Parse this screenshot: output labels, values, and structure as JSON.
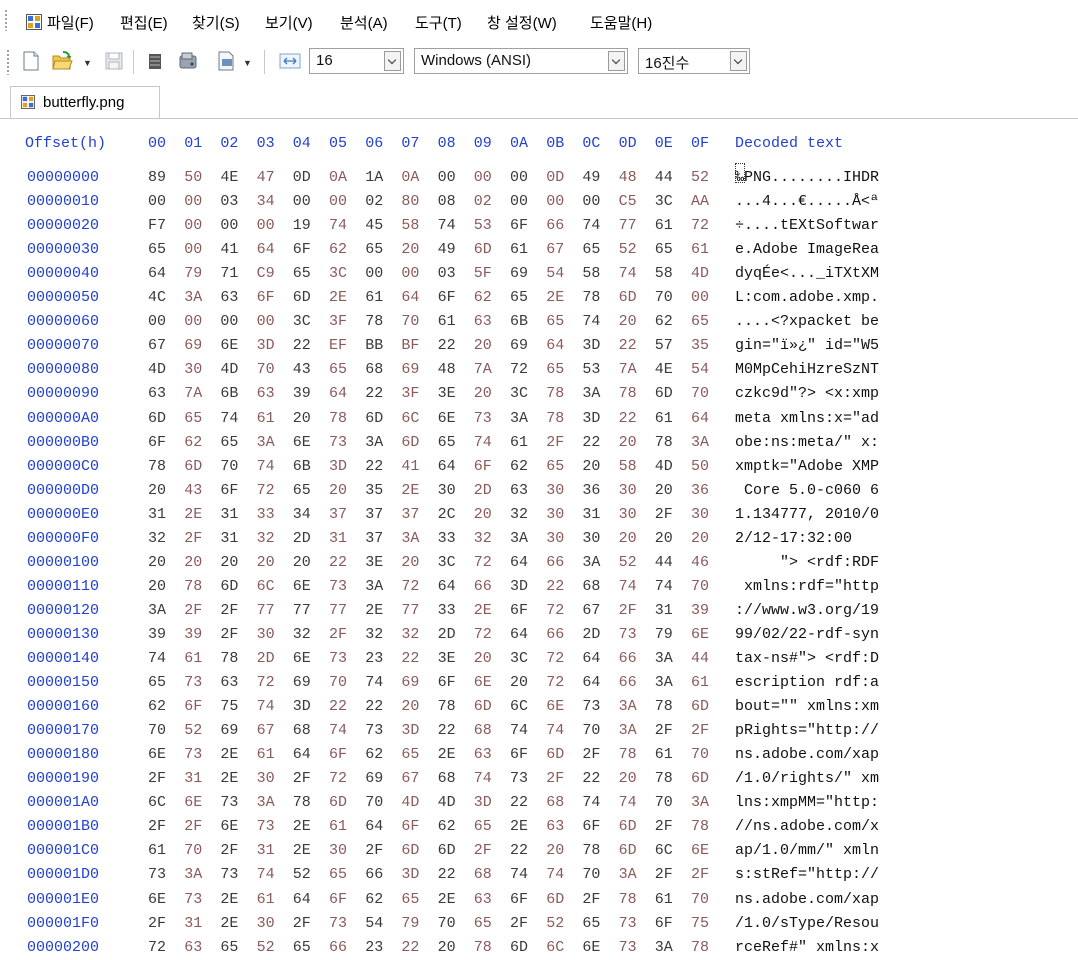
{
  "menu": [
    "파일(F)",
    "편집(E)",
    "찾기(S)",
    "보기(V)",
    "분석(A)",
    "도구(T)",
    "창 설정(W)",
    "도움말(H)"
  ],
  "toolbar": {
    "bytes_per_row": "16",
    "encoding": "Windows (ANSI)",
    "number_format": "16진수",
    "icons": [
      "new-file-icon",
      "open-folder-icon",
      "save-icon",
      "database-icon",
      "disk-icon",
      "export-icon",
      "column-width-icon"
    ]
  },
  "tab": {
    "label": "butterfly.png"
  },
  "colors": {
    "offset_blue": "#2241cf",
    "byte_odd": "#8b5a5a",
    "byte_even": "#3a3a3a"
  },
  "hex": {
    "offset_header": "Offset(h)",
    "column_headers": [
      "00",
      "01",
      "02",
      "03",
      "04",
      "05",
      "06",
      "07",
      "08",
      "09",
      "0A",
      "0B",
      "0C",
      "0D",
      "0E",
      "0F"
    ],
    "decoded_header": "Decoded text",
    "rows": [
      {
        "offset": "00000000",
        "bytes": [
          "89",
          "50",
          "4E",
          "47",
          "0D",
          "0A",
          "1A",
          "0A",
          "00",
          "00",
          "00",
          "0D",
          "49",
          "48",
          "44",
          "52"
        ],
        "decoded": "‰PNG........IHDR"
      },
      {
        "offset": "00000010",
        "bytes": [
          "00",
          "00",
          "03",
          "34",
          "00",
          "00",
          "02",
          "80",
          "08",
          "02",
          "00",
          "00",
          "00",
          "C5",
          "3C",
          "AA"
        ],
        "decoded": "...4...€.....Å<ª"
      },
      {
        "offset": "00000020",
        "bytes": [
          "F7",
          "00",
          "00",
          "00",
          "19",
          "74",
          "45",
          "58",
          "74",
          "53",
          "6F",
          "66",
          "74",
          "77",
          "61",
          "72"
        ],
        "decoded": "÷....tEXtSoftwar"
      },
      {
        "offset": "00000030",
        "bytes": [
          "65",
          "00",
          "41",
          "64",
          "6F",
          "62",
          "65",
          "20",
          "49",
          "6D",
          "61",
          "67",
          "65",
          "52",
          "65",
          "61"
        ],
        "decoded": "e.Adobe ImageRea"
      },
      {
        "offset": "00000040",
        "bytes": [
          "64",
          "79",
          "71",
          "C9",
          "65",
          "3C",
          "00",
          "00",
          "03",
          "5F",
          "69",
          "54",
          "58",
          "74",
          "58",
          "4D"
        ],
        "decoded": "dyqÉe<..._iTXtXM"
      },
      {
        "offset": "00000050",
        "bytes": [
          "4C",
          "3A",
          "63",
          "6F",
          "6D",
          "2E",
          "61",
          "64",
          "6F",
          "62",
          "65",
          "2E",
          "78",
          "6D",
          "70",
          "00"
        ],
        "decoded": "L:com.adobe.xmp."
      },
      {
        "offset": "00000060",
        "bytes": [
          "00",
          "00",
          "00",
          "00",
          "3C",
          "3F",
          "78",
          "70",
          "61",
          "63",
          "6B",
          "65",
          "74",
          "20",
          "62",
          "65"
        ],
        "decoded": "....<?xpacket be"
      },
      {
        "offset": "00000070",
        "bytes": [
          "67",
          "69",
          "6E",
          "3D",
          "22",
          "EF",
          "BB",
          "BF",
          "22",
          "20",
          "69",
          "64",
          "3D",
          "22",
          "57",
          "35"
        ],
        "decoded": "gin=\"ï»¿\" id=\"W5"
      },
      {
        "offset": "00000080",
        "bytes": [
          "4D",
          "30",
          "4D",
          "70",
          "43",
          "65",
          "68",
          "69",
          "48",
          "7A",
          "72",
          "65",
          "53",
          "7A",
          "4E",
          "54"
        ],
        "decoded": "M0MpCehiHzreSzNT"
      },
      {
        "offset": "00000090",
        "bytes": [
          "63",
          "7A",
          "6B",
          "63",
          "39",
          "64",
          "22",
          "3F",
          "3E",
          "20",
          "3C",
          "78",
          "3A",
          "78",
          "6D",
          "70"
        ],
        "decoded": "czkc9d\"?> <x:xmp"
      },
      {
        "offset": "000000A0",
        "bytes": [
          "6D",
          "65",
          "74",
          "61",
          "20",
          "78",
          "6D",
          "6C",
          "6E",
          "73",
          "3A",
          "78",
          "3D",
          "22",
          "61",
          "64"
        ],
        "decoded": "meta xmlns:x=\"ad"
      },
      {
        "offset": "000000B0",
        "bytes": [
          "6F",
          "62",
          "65",
          "3A",
          "6E",
          "73",
          "3A",
          "6D",
          "65",
          "74",
          "61",
          "2F",
          "22",
          "20",
          "78",
          "3A"
        ],
        "decoded": "obe:ns:meta/\" x:"
      },
      {
        "offset": "000000C0",
        "bytes": [
          "78",
          "6D",
          "70",
          "74",
          "6B",
          "3D",
          "22",
          "41",
          "64",
          "6F",
          "62",
          "65",
          "20",
          "58",
          "4D",
          "50"
        ],
        "decoded": "xmptk=\"Adobe XMP"
      },
      {
        "offset": "000000D0",
        "bytes": [
          "20",
          "43",
          "6F",
          "72",
          "65",
          "20",
          "35",
          "2E",
          "30",
          "2D",
          "63",
          "30",
          "36",
          "30",
          "20",
          "36"
        ],
        "decoded": " Core 5.0-c060 6"
      },
      {
        "offset": "000000E0",
        "bytes": [
          "31",
          "2E",
          "31",
          "33",
          "34",
          "37",
          "37",
          "37",
          "2C",
          "20",
          "32",
          "30",
          "31",
          "30",
          "2F",
          "30"
        ],
        "decoded": "1.134777, 2010/0"
      },
      {
        "offset": "000000F0",
        "bytes": [
          "32",
          "2F",
          "31",
          "32",
          "2D",
          "31",
          "37",
          "3A",
          "33",
          "32",
          "3A",
          "30",
          "30",
          "20",
          "20",
          "20"
        ],
        "decoded": "2/12-17:32:00   "
      },
      {
        "offset": "00000100",
        "bytes": [
          "20",
          "20",
          "20",
          "20",
          "20",
          "22",
          "3E",
          "20",
          "3C",
          "72",
          "64",
          "66",
          "3A",
          "52",
          "44",
          "46"
        ],
        "decoded": "     \"> <rdf:RDF"
      },
      {
        "offset": "00000110",
        "bytes": [
          "20",
          "78",
          "6D",
          "6C",
          "6E",
          "73",
          "3A",
          "72",
          "64",
          "66",
          "3D",
          "22",
          "68",
          "74",
          "74",
          "70"
        ],
        "decoded": " xmlns:rdf=\"http"
      },
      {
        "offset": "00000120",
        "bytes": [
          "3A",
          "2F",
          "2F",
          "77",
          "77",
          "77",
          "2E",
          "77",
          "33",
          "2E",
          "6F",
          "72",
          "67",
          "2F",
          "31",
          "39"
        ],
        "decoded": "://www.w3.org/19"
      },
      {
        "offset": "00000130",
        "bytes": [
          "39",
          "39",
          "2F",
          "30",
          "32",
          "2F",
          "32",
          "32",
          "2D",
          "72",
          "64",
          "66",
          "2D",
          "73",
          "79",
          "6E"
        ],
        "decoded": "99/02/22-rdf-syn"
      },
      {
        "offset": "00000140",
        "bytes": [
          "74",
          "61",
          "78",
          "2D",
          "6E",
          "73",
          "23",
          "22",
          "3E",
          "20",
          "3C",
          "72",
          "64",
          "66",
          "3A",
          "44"
        ],
        "decoded": "tax-ns#\"> <rdf:D"
      },
      {
        "offset": "00000150",
        "bytes": [
          "65",
          "73",
          "63",
          "72",
          "69",
          "70",
          "74",
          "69",
          "6F",
          "6E",
          "20",
          "72",
          "64",
          "66",
          "3A",
          "61"
        ],
        "decoded": "escription rdf:a"
      },
      {
        "offset": "00000160",
        "bytes": [
          "62",
          "6F",
          "75",
          "74",
          "3D",
          "22",
          "22",
          "20",
          "78",
          "6D",
          "6C",
          "6E",
          "73",
          "3A",
          "78",
          "6D"
        ],
        "decoded": "bout=\"\" xmlns:xm"
      },
      {
        "offset": "00000170",
        "bytes": [
          "70",
          "52",
          "69",
          "67",
          "68",
          "74",
          "73",
          "3D",
          "22",
          "68",
          "74",
          "74",
          "70",
          "3A",
          "2F",
          "2F"
        ],
        "decoded": "pRights=\"http://"
      },
      {
        "offset": "00000180",
        "bytes": [
          "6E",
          "73",
          "2E",
          "61",
          "64",
          "6F",
          "62",
          "65",
          "2E",
          "63",
          "6F",
          "6D",
          "2F",
          "78",
          "61",
          "70"
        ],
        "decoded": "ns.adobe.com/xap"
      },
      {
        "offset": "00000190",
        "bytes": [
          "2F",
          "31",
          "2E",
          "30",
          "2F",
          "72",
          "69",
          "67",
          "68",
          "74",
          "73",
          "2F",
          "22",
          "20",
          "78",
          "6D"
        ],
        "decoded": "/1.0/rights/\" xm"
      },
      {
        "offset": "000001A0",
        "bytes": [
          "6C",
          "6E",
          "73",
          "3A",
          "78",
          "6D",
          "70",
          "4D",
          "4D",
          "3D",
          "22",
          "68",
          "74",
          "74",
          "70",
          "3A"
        ],
        "decoded": "lns:xmpMM=\"http:"
      },
      {
        "offset": "000001B0",
        "bytes": [
          "2F",
          "2F",
          "6E",
          "73",
          "2E",
          "61",
          "64",
          "6F",
          "62",
          "65",
          "2E",
          "63",
          "6F",
          "6D",
          "2F",
          "78"
        ],
        "decoded": "//ns.adobe.com/x"
      },
      {
        "offset": "000001C0",
        "bytes": [
          "61",
          "70",
          "2F",
          "31",
          "2E",
          "30",
          "2F",
          "6D",
          "6D",
          "2F",
          "22",
          "20",
          "78",
          "6D",
          "6C",
          "6E"
        ],
        "decoded": "ap/1.0/mm/\" xmln"
      },
      {
        "offset": "000001D0",
        "bytes": [
          "73",
          "3A",
          "73",
          "74",
          "52",
          "65",
          "66",
          "3D",
          "22",
          "68",
          "74",
          "74",
          "70",
          "3A",
          "2F",
          "2F"
        ],
        "decoded": "s:stRef=\"http://"
      },
      {
        "offset": "000001E0",
        "bytes": [
          "6E",
          "73",
          "2E",
          "61",
          "64",
          "6F",
          "62",
          "65",
          "2E",
          "63",
          "6F",
          "6D",
          "2F",
          "78",
          "61",
          "70"
        ],
        "decoded": "ns.adobe.com/xap"
      },
      {
        "offset": "000001F0",
        "bytes": [
          "2F",
          "31",
          "2E",
          "30",
          "2F",
          "73",
          "54",
          "79",
          "70",
          "65",
          "2F",
          "52",
          "65",
          "73",
          "6F",
          "75"
        ],
        "decoded": "/1.0/sType/Resou"
      },
      {
        "offset": "00000200",
        "bytes": [
          "72",
          "63",
          "65",
          "52",
          "65",
          "66",
          "23",
          "22",
          "20",
          "78",
          "6D",
          "6C",
          "6E",
          "73",
          "3A",
          "78"
        ],
        "decoded": "rceRef#\" xmlns:x"
      }
    ]
  }
}
